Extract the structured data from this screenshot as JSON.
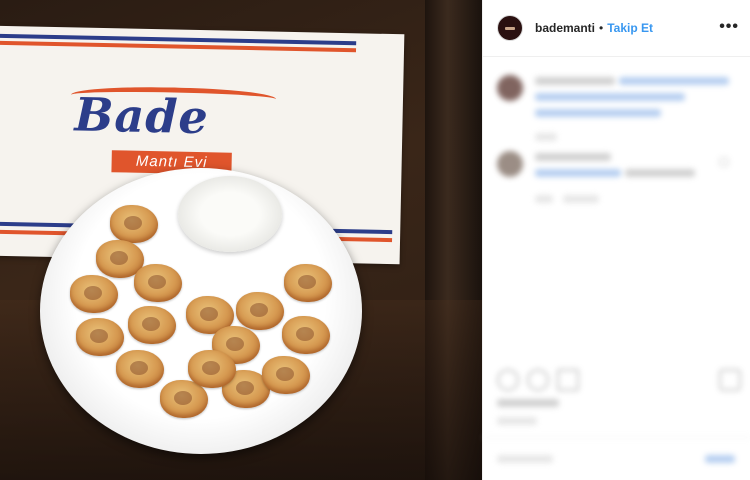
{
  "post": {
    "image": {
      "description": "photo",
      "logo_word": "Bade",
      "logo_sub": "Mantı Evi"
    }
  },
  "header": {
    "username": "bademanti",
    "separator": "•",
    "follow_label": "Takip Et",
    "more_label": "•••"
  },
  "icons": {
    "avatar": "profile-avatar-icon",
    "more": "more-options-icon",
    "like": "heart-icon",
    "comment": "comment-icon",
    "share": "share-icon",
    "save": "bookmark-icon"
  },
  "colors": {
    "follow": "#3897f0",
    "brand_blue": "#2c3d8a",
    "brand_orange": "#e0552c"
  }
}
